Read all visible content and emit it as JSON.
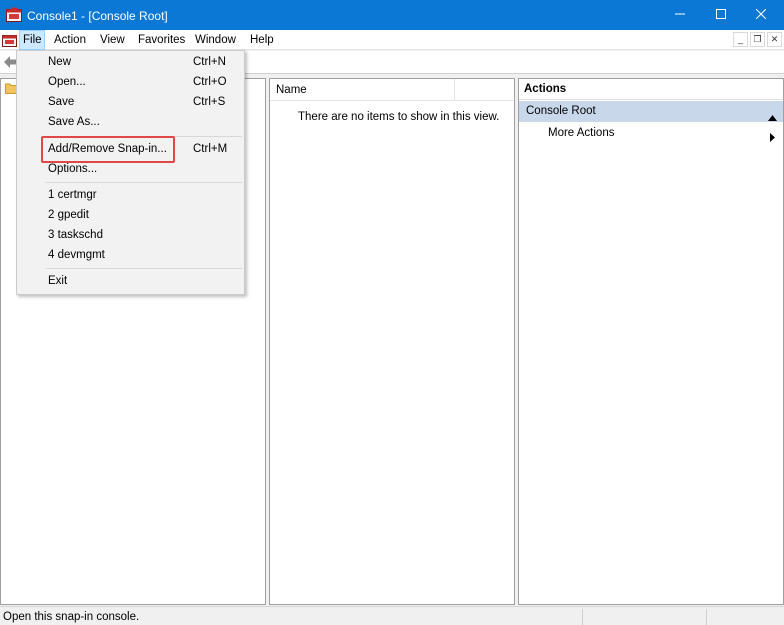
{
  "window": {
    "title": "Console1 - [Console Root]",
    "accent_color": "#0a78d4"
  },
  "menubar": {
    "items": [
      "File",
      "Action",
      "View",
      "Favorites",
      "Window",
      "Help"
    ]
  },
  "file_menu": {
    "items": [
      {
        "label": "New",
        "shortcut": "Ctrl+N"
      },
      {
        "label": "Open...",
        "shortcut": "Ctrl+O"
      },
      {
        "label": "Save",
        "shortcut": "Ctrl+S"
      },
      {
        "label": "Save As...",
        "shortcut": ""
      },
      {
        "label": "Add/Remove Snap-in...",
        "shortcut": "Ctrl+M"
      },
      {
        "label": "Options...",
        "shortcut": ""
      },
      {
        "label": "1 certmgr",
        "shortcut": ""
      },
      {
        "label": "2 gpedit",
        "shortcut": ""
      },
      {
        "label": "3 taskschd",
        "shortcut": ""
      },
      {
        "label": "4 devmgmt",
        "shortcut": ""
      },
      {
        "label": "Exit",
        "shortcut": ""
      }
    ],
    "highlight_color": "#e04848"
  },
  "list_pane": {
    "column_name": "Name",
    "empty_message": "There are no items to show in this view."
  },
  "actions_pane": {
    "title": "Actions",
    "section": "Console Root",
    "section_color": "#c8d7ea",
    "item": "More Actions"
  },
  "statusbar": {
    "text": "Open this snap-in console."
  }
}
